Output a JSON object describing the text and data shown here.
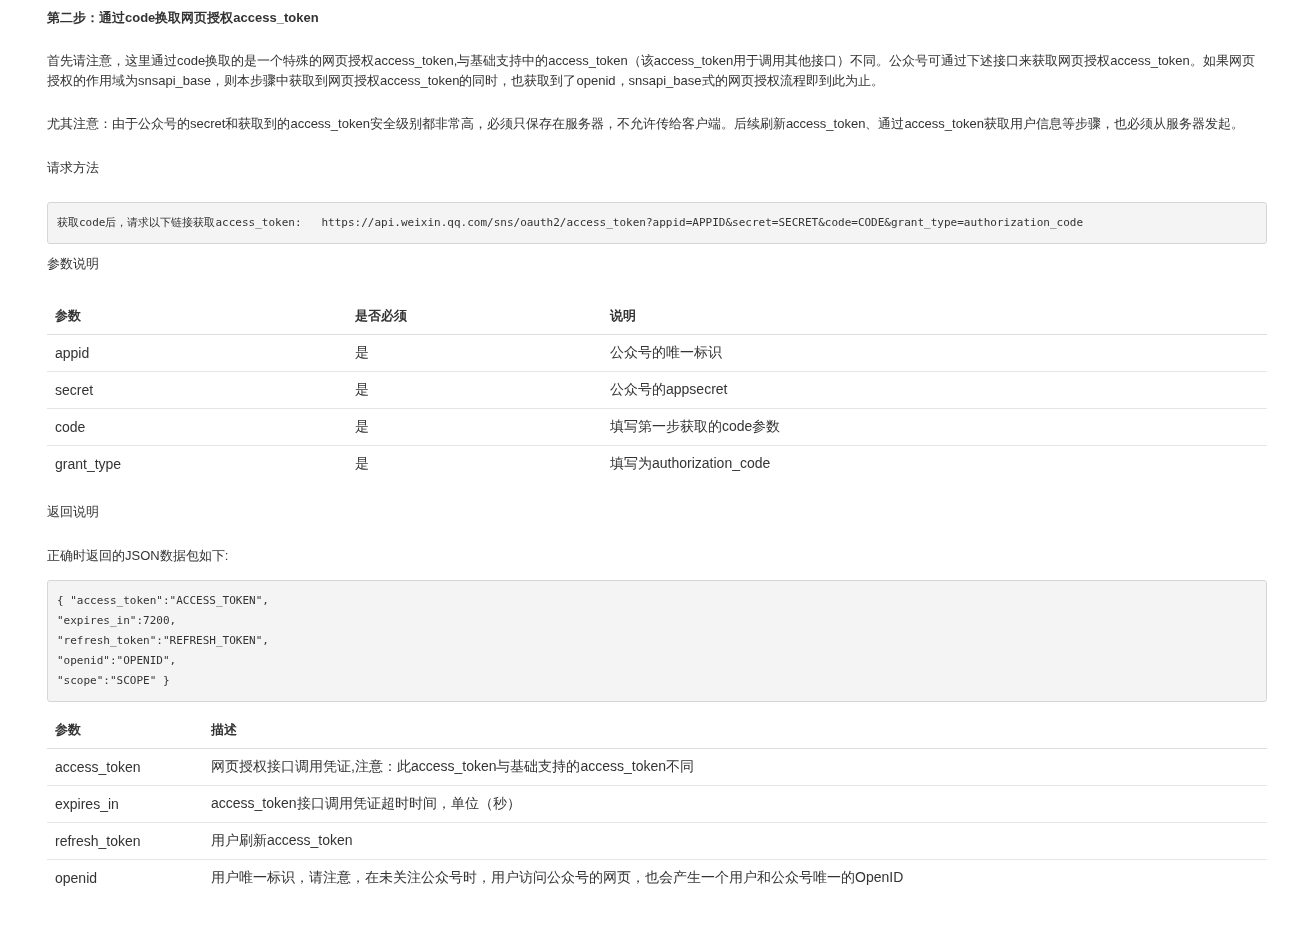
{
  "heading": "第二步：通过code换取网页授权access_token",
  "paragraphs": [
    "首先请注意，这里通过code换取的是一个特殊的网页授权access_token,与基础支持中的access_token（该access_token用于调用其他接口）不同。公众号可通过下述接口来获取网页授权access_token。如果网页授权的作用域为snsapi_base，则本步骤中获取到网页授权access_token的同时，也获取到了openid，snsapi_base式的网页授权流程即到此为止。",
    "尤其注意：由于公众号的secret和获取到的access_token安全级别都非常高，必须只保存在服务器，不允许传给客户端。后续刷新access_token、通过access_token获取用户信息等步骤，也必须从服务器发起。"
  ],
  "request_label": "请求方法",
  "request_code": [
    "获取code后，请求以下链接获取access_token:   https://api.weixin.qq.com/sns/oauth2/access_token?appid=APPID&secret=SECRET&code=CODE&grant_type=authorization_code"
  ],
  "params_label": "参数说明",
  "params_table": {
    "columns": [
      "参数",
      "是否必须",
      "说明"
    ],
    "rows": [
      [
        "appid",
        "是",
        "公众号的唯一标识"
      ],
      [
        "secret",
        "是",
        "公众号的appsecret"
      ],
      [
        "code",
        "是",
        "填写第一步获取的code参数"
      ],
      [
        "grant_type",
        "是",
        "填写为authorization_code"
      ]
    ]
  },
  "return_label": "返回说明",
  "return_intro": "正确时返回的JSON数据包如下:",
  "return_code": [
    "{ \"access_token\":\"ACCESS_TOKEN\",",
    "\"expires_in\":7200,",
    "\"refresh_token\":\"REFRESH_TOKEN\",",
    "\"openid\":\"OPENID\",",
    "\"scope\":\"SCOPE\" }"
  ],
  "return_table": {
    "columns": [
      "参数",
      "描述"
    ],
    "rows": [
      [
        "access_token",
        "网页授权接口调用凭证,注意：此access_token与基础支持的access_token不同"
      ],
      [
        "expires_in",
        "access_token接口调用凭证超时时间，单位（秒）"
      ],
      [
        "refresh_token",
        "用户刷新access_token"
      ],
      [
        "openid",
        "用户唯一标识，请注意，在未关注公众号时，用户访问公众号的网页，也会产生一个用户和公众号唯一的OpenID"
      ]
    ]
  }
}
